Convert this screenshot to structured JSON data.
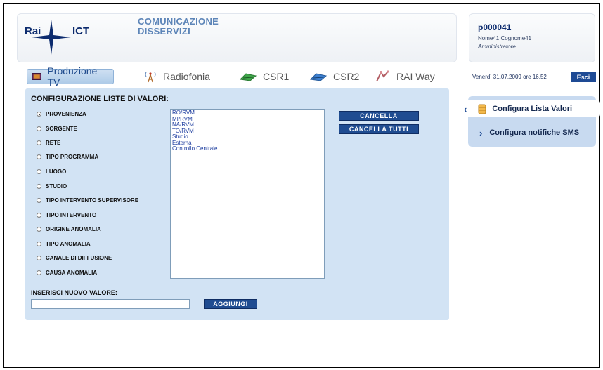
{
  "brand": {
    "logo_left": "Rai",
    "logo_right": "ICT",
    "title_line1": "COMUNICAZIONE",
    "title_line2": "DISSERVIZI"
  },
  "user": {
    "id": "p000041",
    "name": "Nome41 Cognome41",
    "role": "Amministratore"
  },
  "tabs": [
    {
      "label": "Produzione TV",
      "icon": "tv-icon",
      "active": true
    },
    {
      "label": "Radiofonia",
      "icon": "radio-antenna-icon",
      "active": false
    },
    {
      "label": "CSR1",
      "icon": "satellite-dish-icon",
      "active": false
    },
    {
      "label": "CSR2",
      "icon": "satellite-dish-icon",
      "active": false
    },
    {
      "label": "RAI Way",
      "icon": "network-icon",
      "active": false
    }
  ],
  "datetime": "Venerdì 31.07.2009 ore 16.52",
  "logout_label": "Esci",
  "config": {
    "title": "CONFIGURAZIONE LISTE DI VALORI:",
    "options": [
      "PROVENIENZA",
      "SORGENTE",
      "RETE",
      "TIPO PROGRAMMA",
      "LUOGO",
      "STUDIO",
      "TIPO INTERVENTO SUPERVISORE",
      "TIPO INTERVENTO",
      "ORIGINE ANOMALIA",
      "TIPO ANOMALIA",
      "CANALE DI DIFFUSIONE",
      "CAUSA ANOMALIA"
    ],
    "selected_option": "PROVENIENZA",
    "values": [
      "RO/RVM",
      "MI/RVM",
      "NA/RVM",
      "TO/RVM",
      "Studio",
      "Esterna",
      "Controllo Centrale"
    ],
    "cancel_label": "CANCELLA",
    "cancel_all_label": "CANCELLA TUTTI",
    "insert_label": "INSERISCI NUOVO VALORE:",
    "insert_value": "",
    "add_label": "AGGIUNGI"
  },
  "side_menu": [
    {
      "label": "Configura Lista Valori",
      "active": true
    },
    {
      "label": "Configura notifiche SMS",
      "active": false
    }
  ],
  "colors": {
    "accent": "#1f4c91",
    "panel": "#d2e3f4",
    "brand_text": "#0c2b6e"
  }
}
